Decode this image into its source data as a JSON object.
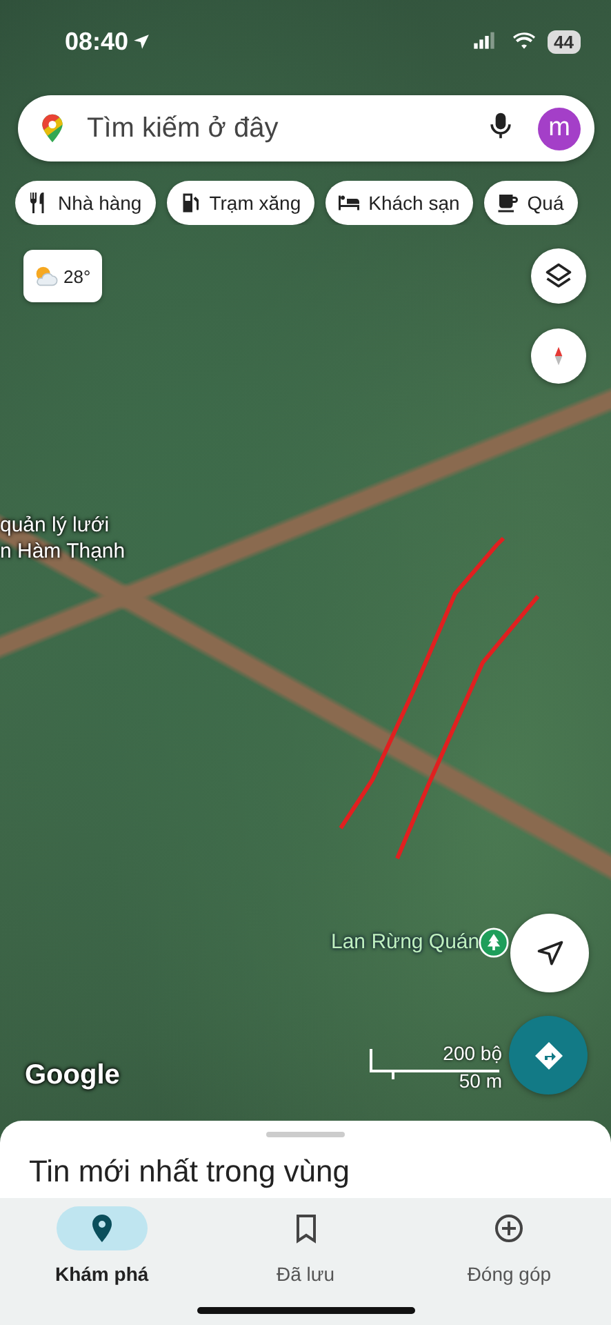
{
  "status_bar": {
    "time": "08:40",
    "battery": "44"
  },
  "search": {
    "placeholder": "Tìm kiếm ở đây",
    "avatar_letter": "m"
  },
  "chips": [
    {
      "label": "Nhà hàng",
      "kind": "restaurant"
    },
    {
      "label": "Trạm xăng",
      "kind": "gas"
    },
    {
      "label": "Khách sạn",
      "kind": "hotel"
    },
    {
      "label": "Quá",
      "kind": "cafe"
    }
  ],
  "weather": {
    "temperature": "28°"
  },
  "map": {
    "labels": [
      {
        "text": "quản lý lưới"
      },
      {
        "text": "n Hàm Thạnh"
      }
    ],
    "place": {
      "name": "Lan Rừng Quán"
    },
    "scale": {
      "imperial": "200 bộ",
      "metric": "50 m"
    },
    "attribution": "Google"
  },
  "sheet": {
    "title": "Tin mới nhất trong vùng"
  },
  "nav": [
    {
      "label": "Khám phá",
      "kind": "explore",
      "selected": true
    },
    {
      "label": "Đã lưu",
      "kind": "saved",
      "selected": false
    },
    {
      "label": "Đóng góp",
      "kind": "contribute",
      "selected": false
    }
  ]
}
